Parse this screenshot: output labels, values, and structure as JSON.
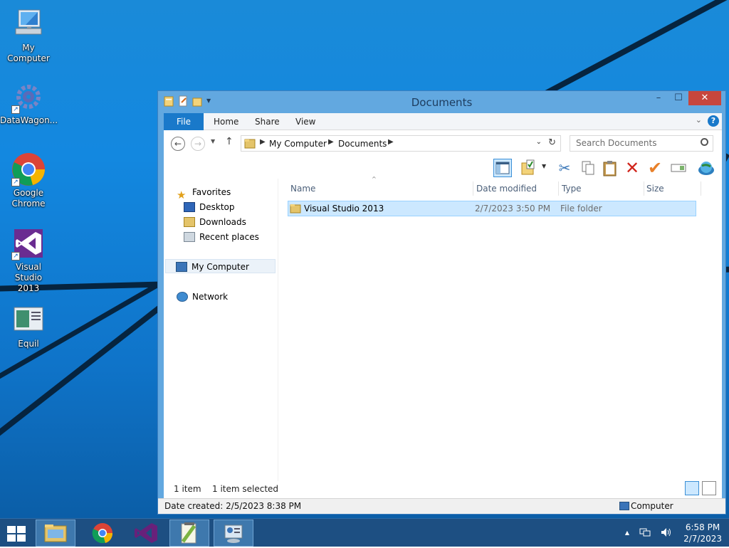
{
  "desktop": {
    "icons": [
      {
        "label": "My Computer"
      },
      {
        "label": "DataWagon..."
      },
      {
        "label": "Google Chrome"
      },
      {
        "label": "Visual Studio 2013"
      },
      {
        "label": "Equil"
      }
    ]
  },
  "window": {
    "title": "Documents",
    "controls": {
      "minimize": "–",
      "maximize": "☐",
      "close": "✕"
    },
    "ribbon": {
      "file": "File",
      "home": "Home",
      "share": "Share",
      "view": "View",
      "help": "?"
    },
    "address": {
      "crumbs": [
        "My Computer",
        "Documents"
      ]
    },
    "search": {
      "placeholder": "Search Documents"
    },
    "nav_pane": {
      "favorites": "Favorites",
      "desktop": "Desktop",
      "downloads": "Downloads",
      "recent": "Recent places",
      "my_computer": "My Computer",
      "network": "Network"
    },
    "columns": {
      "name": "Name",
      "date": "Date modified",
      "type": "Type",
      "size": "Size"
    },
    "files": [
      {
        "name": "Visual Studio 2013",
        "date": "2/7/2023 3:50 PM",
        "type": "File folder",
        "size": ""
      }
    ],
    "status": {
      "count": "1 item",
      "selected": "1 item selected"
    },
    "details": {
      "created": "Date created: 2/5/2023 8:38 PM",
      "location": "Computer"
    }
  },
  "taskbar": {
    "time": "6:58 PM",
    "date": "2/7/2023",
    "tray_up": "▲"
  },
  "colors": {
    "accent": "#1979ca",
    "selection": "#cce8ff",
    "taskbar": "#1d4f82"
  }
}
